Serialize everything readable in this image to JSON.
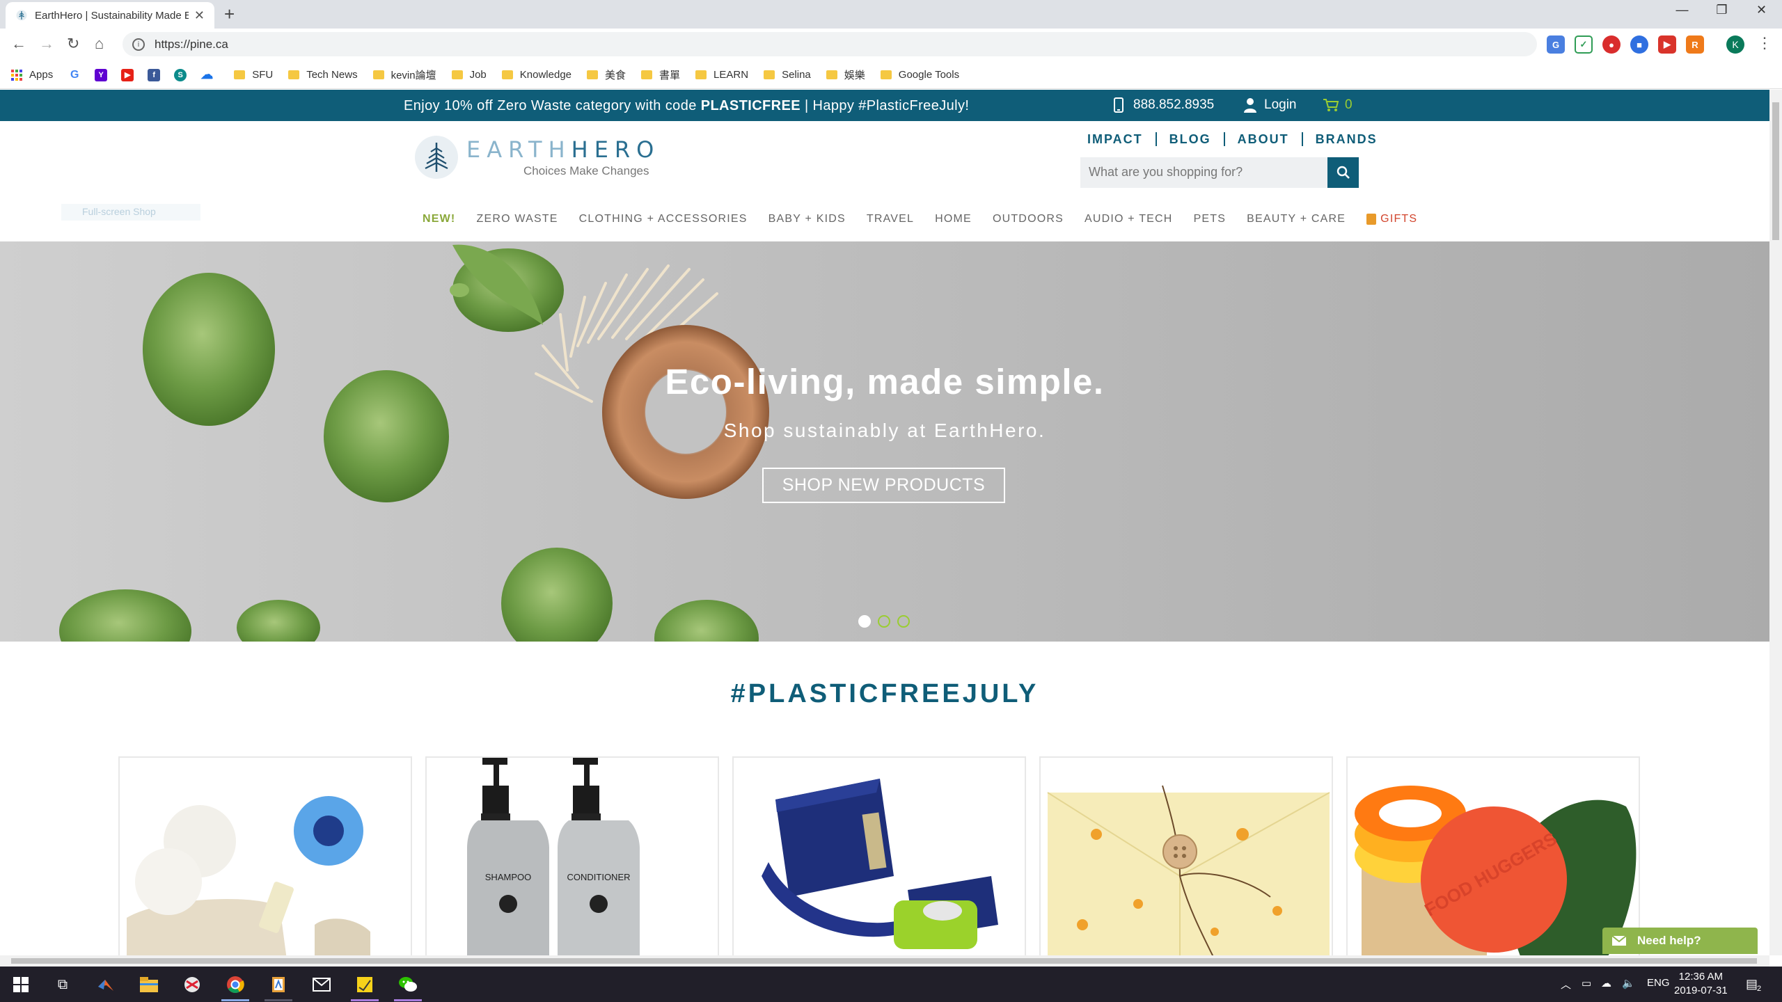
{
  "browser": {
    "tab_title": "EarthHero | Sustainability Made E",
    "url": "https://pine.ca",
    "bookmarks": [
      {
        "label": "Apps"
      },
      {
        "label": "SFU"
      },
      {
        "label": "Tech News"
      },
      {
        "label": "kevin論壇"
      },
      {
        "label": "Job"
      },
      {
        "label": "Knowledge"
      },
      {
        "label": "美食"
      },
      {
        "label": "書單"
      },
      {
        "label": "LEARN"
      },
      {
        "label": "Selina"
      },
      {
        "label": "娛樂"
      },
      {
        "label": "Google Tools"
      }
    ],
    "profile_initial": "K"
  },
  "promo": {
    "text_before": "Enjoy 10% off Zero Waste category with code ",
    "code": "PLASTICFREE",
    "text_after": " | Happy #PlasticFreeJuly!",
    "phone": "888.852.8935",
    "login": "Login",
    "cart_count": "0"
  },
  "header": {
    "logo_earth": "EARTH",
    "logo_hero": "HERO",
    "logo_tagline": "Choices Make Changes",
    "top_links": [
      "IMPACT",
      "BLOG",
      "ABOUT",
      "BRANDS"
    ],
    "search_placeholder": "What are you shopping for?",
    "skip_link": "Full-screen Shop"
  },
  "nav": {
    "items": [
      "NEW!",
      "ZERO WASTE",
      "CLOTHING + ACCESSORIES",
      "BABY + KIDS",
      "TRAVEL",
      "HOME",
      "OUTDOORS",
      "AUDIO + TECH",
      "PETS",
      "BEAUTY + CARE",
      "GIFTS"
    ]
  },
  "hero": {
    "headline": "Eco-living, made simple.",
    "subheadline": "Shop sustainably at EarthHero.",
    "cta": "SHOP NEW PRODUCTS",
    "slide_count": 3,
    "active_slide": 1
  },
  "section": {
    "title": "#PLASTICFREEJULY"
  },
  "products": [
    {
      "image": "dryer-balls-and-mesh-bags"
    },
    {
      "image": "shampoo-conditioner-bottles",
      "labels": [
        "SHAMPOO",
        "CONDITIONER"
      ]
    },
    {
      "image": "navy-lunch-bag-set"
    },
    {
      "image": "beeswax-food-wrap"
    },
    {
      "image": "food-huggers-silicone-savers",
      "labels": [
        "FOOD HUGGERS"
      ]
    }
  ],
  "help_widget": {
    "label": "Need help?"
  },
  "taskbar": {
    "language": "ENG",
    "time": "12:36 AM",
    "date": "2019-07-31",
    "notifications": "2"
  },
  "colors": {
    "brand_teal": "#0f5d78",
    "accent_green": "#9acd32",
    "nav_new": "#8aa83a",
    "gifts_red": "#d2452d"
  }
}
